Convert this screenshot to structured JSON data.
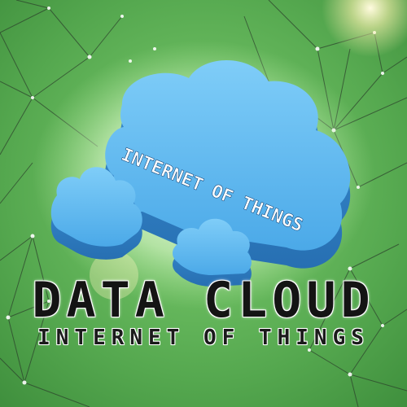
{
  "cloud_label": "INTERNET OF THINGS",
  "headline": "DATA CLOUD",
  "subheadline": "INTERNET OF THINGS",
  "colors": {
    "background": "#5fb35a",
    "cloud_top": "#5ab6ee",
    "cloud_side": "#2f7fc4",
    "network_lines": "#2d3b2d",
    "network_nodes": "#ffffff",
    "headline": "#141414"
  }
}
